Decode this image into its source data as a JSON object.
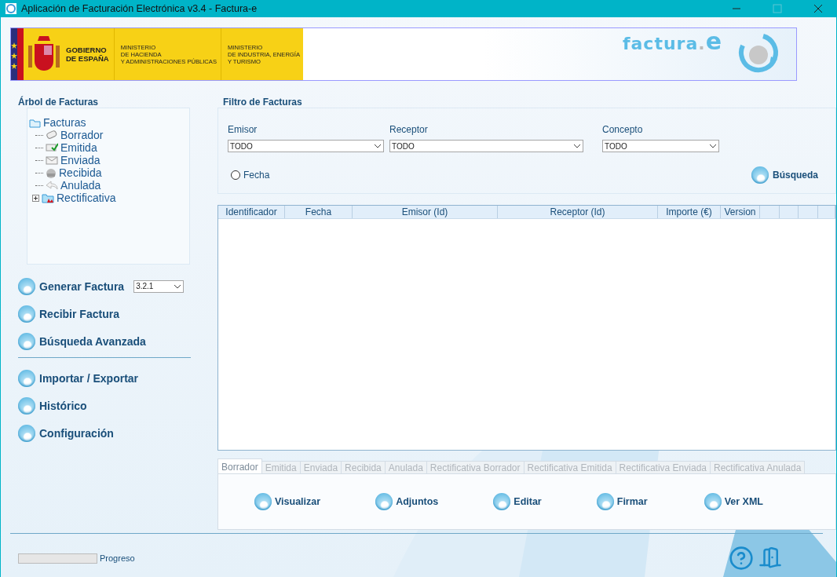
{
  "window": {
    "title": "Aplicación de Facturación Electrónica v3.4 - Factura-e"
  },
  "banner": {
    "government": [
      "GOBIERNO",
      "DE ESPAÑA"
    ],
    "ministries": [
      [
        "MINISTERIO",
        "DE HACIENDA",
        "Y ADMINISTRACIONES PÚBLICAS"
      ],
      [
        "MINISTERIO",
        "DE INDUSTRIA, ENERGÍA",
        "Y TURISMO"
      ]
    ],
    "logo_text": "factura",
    "logo_dot": ".",
    "logo_e": "e"
  },
  "tree": {
    "title": "Árbol de Facturas",
    "root": {
      "label": "Facturas",
      "children": [
        {
          "label": "Borrador",
          "kind": "draft"
        },
        {
          "label": "Emitida",
          "kind": "issued"
        },
        {
          "label": "Enviada",
          "kind": "sent"
        },
        {
          "label": "Recibida",
          "kind": "received"
        },
        {
          "label": "Anulada",
          "kind": "cancelled"
        },
        {
          "label": "Rectificativa",
          "kind": "corrective",
          "expanded": false
        }
      ]
    }
  },
  "menu_groups": [
    [
      {
        "label": "Generar Factura",
        "version": "3.2.1"
      },
      {
        "label": "Recibir Factura"
      },
      {
        "label": "Búsqueda Avanzada"
      }
    ],
    [
      {
        "label": "Importar / Exportar"
      },
      {
        "label": "Histórico"
      },
      {
        "label": "Configuración"
      }
    ]
  ],
  "filter": {
    "title": "Filtro de Facturas",
    "fields": [
      {
        "label": "Emisor",
        "value": "TODO"
      },
      {
        "label": "Receptor",
        "value": "TODO"
      },
      {
        "label": "Concepto",
        "value": "TODO"
      }
    ],
    "date_option": {
      "label": "Fecha",
      "selected": false
    },
    "search_button": "Búsqueda"
  },
  "table": {
    "columns": [
      "Identificador",
      "Fecha",
      "Emisor (Id)",
      "Receptor (Id)",
      "Importe (€)",
      "Version"
    ]
  },
  "tabs": [
    {
      "label": "Borrador",
      "selected": true,
      "disabled": false
    },
    {
      "label": "Emitida",
      "selected": false,
      "disabled": true
    },
    {
      "label": "Enviada",
      "selected": false,
      "disabled": true
    },
    {
      "label": "Recibida",
      "selected": false,
      "disabled": true
    },
    {
      "label": "Anulada",
      "selected": false,
      "disabled": true
    },
    {
      "label": "Rectificativa Borrador",
      "selected": false,
      "disabled": true
    },
    {
      "label": "Rectificativa Emitida",
      "selected": false,
      "disabled": true
    },
    {
      "label": "Rectificativa Enviada",
      "selected": false,
      "disabled": true
    },
    {
      "label": "Rectificativa Anulada",
      "selected": false,
      "disabled": true
    }
  ],
  "actions": [
    "Visualizar",
    "Adjuntos",
    "Editar",
    "Firmar",
    "Ver XML"
  ],
  "status": {
    "progress": {
      "label": "Progreso",
      "level": 0
    }
  }
}
